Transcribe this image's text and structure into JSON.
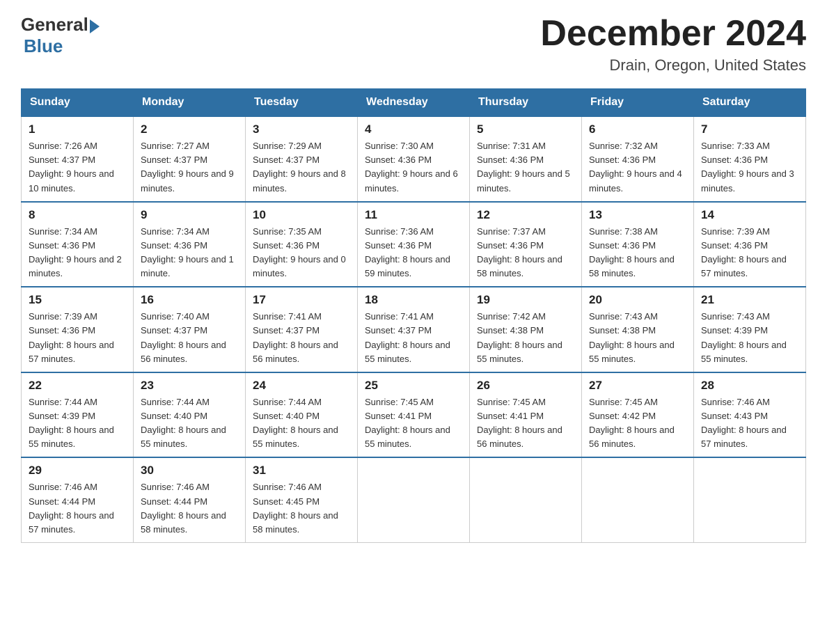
{
  "header": {
    "logo_general": "General",
    "logo_blue": "Blue",
    "month_title": "December 2024",
    "location": "Drain, Oregon, United States"
  },
  "days_of_week": [
    "Sunday",
    "Monday",
    "Tuesday",
    "Wednesday",
    "Thursday",
    "Friday",
    "Saturday"
  ],
  "weeks": [
    [
      {
        "day": "1",
        "sunrise": "7:26 AM",
        "sunset": "4:37 PM",
        "daylight": "9 hours and 10 minutes."
      },
      {
        "day": "2",
        "sunrise": "7:27 AM",
        "sunset": "4:37 PM",
        "daylight": "9 hours and 9 minutes."
      },
      {
        "day": "3",
        "sunrise": "7:29 AM",
        "sunset": "4:37 PM",
        "daylight": "9 hours and 8 minutes."
      },
      {
        "day": "4",
        "sunrise": "7:30 AM",
        "sunset": "4:36 PM",
        "daylight": "9 hours and 6 minutes."
      },
      {
        "day": "5",
        "sunrise": "7:31 AM",
        "sunset": "4:36 PM",
        "daylight": "9 hours and 5 minutes."
      },
      {
        "day": "6",
        "sunrise": "7:32 AM",
        "sunset": "4:36 PM",
        "daylight": "9 hours and 4 minutes."
      },
      {
        "day": "7",
        "sunrise": "7:33 AM",
        "sunset": "4:36 PM",
        "daylight": "9 hours and 3 minutes."
      }
    ],
    [
      {
        "day": "8",
        "sunrise": "7:34 AM",
        "sunset": "4:36 PM",
        "daylight": "9 hours and 2 minutes."
      },
      {
        "day": "9",
        "sunrise": "7:34 AM",
        "sunset": "4:36 PM",
        "daylight": "9 hours and 1 minute."
      },
      {
        "day": "10",
        "sunrise": "7:35 AM",
        "sunset": "4:36 PM",
        "daylight": "9 hours and 0 minutes."
      },
      {
        "day": "11",
        "sunrise": "7:36 AM",
        "sunset": "4:36 PM",
        "daylight": "8 hours and 59 minutes."
      },
      {
        "day": "12",
        "sunrise": "7:37 AM",
        "sunset": "4:36 PM",
        "daylight": "8 hours and 58 minutes."
      },
      {
        "day": "13",
        "sunrise": "7:38 AM",
        "sunset": "4:36 PM",
        "daylight": "8 hours and 58 minutes."
      },
      {
        "day": "14",
        "sunrise": "7:39 AM",
        "sunset": "4:36 PM",
        "daylight": "8 hours and 57 minutes."
      }
    ],
    [
      {
        "day": "15",
        "sunrise": "7:39 AM",
        "sunset": "4:36 PM",
        "daylight": "8 hours and 57 minutes."
      },
      {
        "day": "16",
        "sunrise": "7:40 AM",
        "sunset": "4:37 PM",
        "daylight": "8 hours and 56 minutes."
      },
      {
        "day": "17",
        "sunrise": "7:41 AM",
        "sunset": "4:37 PM",
        "daylight": "8 hours and 56 minutes."
      },
      {
        "day": "18",
        "sunrise": "7:41 AM",
        "sunset": "4:37 PM",
        "daylight": "8 hours and 55 minutes."
      },
      {
        "day": "19",
        "sunrise": "7:42 AM",
        "sunset": "4:38 PM",
        "daylight": "8 hours and 55 minutes."
      },
      {
        "day": "20",
        "sunrise": "7:43 AM",
        "sunset": "4:38 PM",
        "daylight": "8 hours and 55 minutes."
      },
      {
        "day": "21",
        "sunrise": "7:43 AM",
        "sunset": "4:39 PM",
        "daylight": "8 hours and 55 minutes."
      }
    ],
    [
      {
        "day": "22",
        "sunrise": "7:44 AM",
        "sunset": "4:39 PM",
        "daylight": "8 hours and 55 minutes."
      },
      {
        "day": "23",
        "sunrise": "7:44 AM",
        "sunset": "4:40 PM",
        "daylight": "8 hours and 55 minutes."
      },
      {
        "day": "24",
        "sunrise": "7:44 AM",
        "sunset": "4:40 PM",
        "daylight": "8 hours and 55 minutes."
      },
      {
        "day": "25",
        "sunrise": "7:45 AM",
        "sunset": "4:41 PM",
        "daylight": "8 hours and 55 minutes."
      },
      {
        "day": "26",
        "sunrise": "7:45 AM",
        "sunset": "4:41 PM",
        "daylight": "8 hours and 56 minutes."
      },
      {
        "day": "27",
        "sunrise": "7:45 AM",
        "sunset": "4:42 PM",
        "daylight": "8 hours and 56 minutes."
      },
      {
        "day": "28",
        "sunrise": "7:46 AM",
        "sunset": "4:43 PM",
        "daylight": "8 hours and 57 minutes."
      }
    ],
    [
      {
        "day": "29",
        "sunrise": "7:46 AM",
        "sunset": "4:44 PM",
        "daylight": "8 hours and 57 minutes."
      },
      {
        "day": "30",
        "sunrise": "7:46 AM",
        "sunset": "4:44 PM",
        "daylight": "8 hours and 58 minutes."
      },
      {
        "day": "31",
        "sunrise": "7:46 AM",
        "sunset": "4:45 PM",
        "daylight": "8 hours and 58 minutes."
      },
      null,
      null,
      null,
      null
    ]
  ]
}
